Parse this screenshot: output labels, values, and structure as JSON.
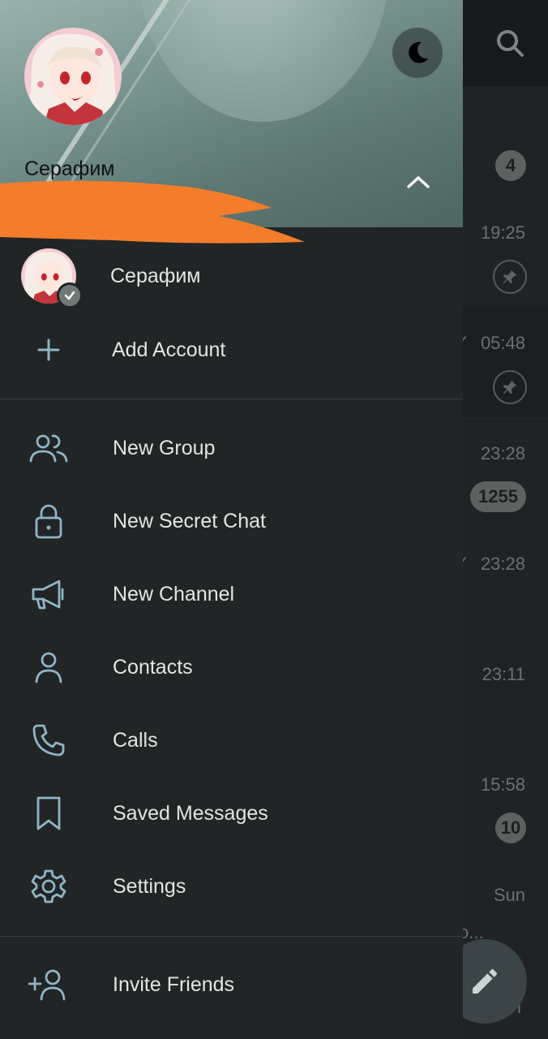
{
  "chat_list": {
    "rows": [
      {
        "time": "",
        "badge": "4",
        "badge_type": "count",
        "check": false,
        "snippet": ""
      },
      {
        "time": "19:25",
        "badge": "",
        "badge_type": "pin",
        "check": false,
        "snippet": ""
      },
      {
        "time": "05:48",
        "badge": "",
        "badge_type": "pin",
        "check": true,
        "snippet": ""
      },
      {
        "time": "23:28",
        "badge": "1255",
        "badge_type": "count",
        "check": false,
        "snippet": ""
      },
      {
        "time": "23:28",
        "badge": "",
        "badge_type": "none",
        "check": true,
        "snippet": ""
      },
      {
        "time": "23:11",
        "badge": "",
        "badge_type": "none",
        "check": false,
        "snippet": ""
      },
      {
        "time": "15:58",
        "badge": "10",
        "badge_type": "count",
        "check": false,
        "snippet": ""
      },
      {
        "time": "Sun",
        "badge": "",
        "badge_type": "none",
        "check": false,
        "snippet": "о..."
      }
    ],
    "fab_icon": "pencil-icon",
    "fab_tail_text": "l"
  },
  "drawer": {
    "header": {
      "name": "Серафим",
      "night_mode_icon": "moon-icon",
      "expand_icon": "chevron-up-icon"
    },
    "accounts": [
      {
        "name": "Серафим",
        "active": true
      }
    ],
    "add_account_label": "Add Account",
    "menu": [
      {
        "label": "New Group",
        "icon": "group-icon"
      },
      {
        "label": "New Secret Chat",
        "icon": "lock-icon"
      },
      {
        "label": "New Channel",
        "icon": "megaphone-icon"
      },
      {
        "label": "Contacts",
        "icon": "person-icon"
      },
      {
        "label": "Calls",
        "icon": "phone-icon"
      },
      {
        "label": "Saved Messages",
        "icon": "bookmark-icon"
      },
      {
        "label": "Settings",
        "icon": "gear-icon"
      }
    ],
    "footer_menu": [
      {
        "label": "Invite Friends",
        "icon": "add-person-icon"
      }
    ]
  },
  "colors": {
    "drawer_bg": "#212526",
    "text_primary": "#dfe7e4",
    "icon": "#8fb5c6",
    "redaction": "#f47d2b"
  }
}
